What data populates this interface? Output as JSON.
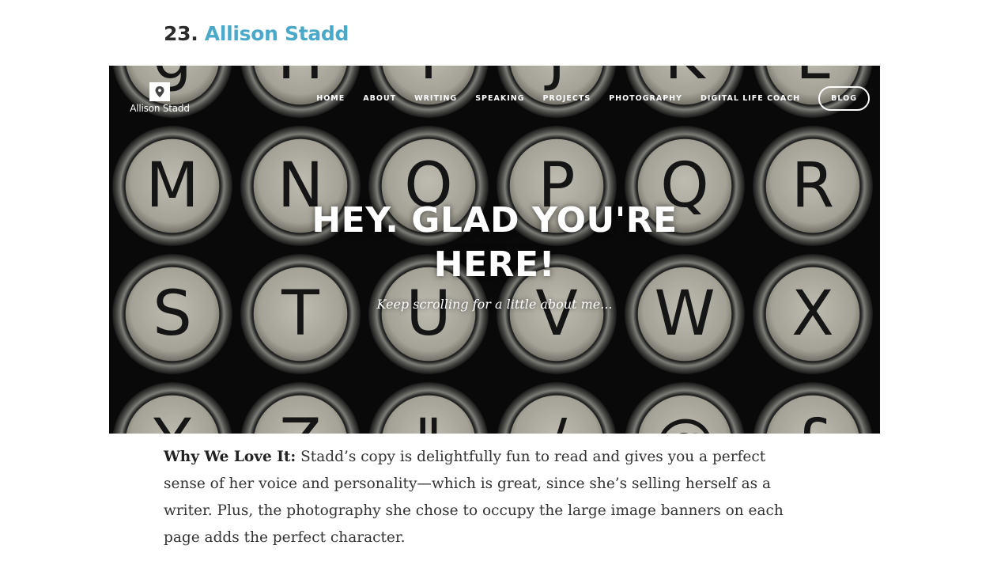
{
  "heading": {
    "number": "23.",
    "name": "Allison Stadd"
  },
  "screenshot": {
    "logo_text": "Allison Stadd",
    "nav": [
      "HOME",
      "ABOUT",
      "WRITING",
      "SPEAKING",
      "PROJECTS",
      "PHOTOGRAPHY",
      "DIGITAL LIFE COACH"
    ],
    "nav_button": "BLOG",
    "hero_line1": "HEY. GLAD YOU'RE",
    "hero_line2": "HERE!",
    "hero_subtitle": "Keep scrolling for a little about me...",
    "key_letters": [
      "g",
      "H",
      "I",
      "J",
      "K",
      "L",
      "M",
      "N",
      "O",
      "P",
      "Q",
      "R",
      "S",
      "T",
      "U",
      "V",
      "W",
      "X",
      "Y",
      "Z",
      "\"",
      "/",
      "@",
      "£"
    ]
  },
  "body": {
    "lead": "Why We Love It:",
    "text": " Stadd’s copy is delightfully fun to read and gives you a perfect sense of her voice and personality—which is great, since she’s selling herself as a writer. Plus, the photography she chose to occupy the large image banners on each page adds the perfect character."
  }
}
